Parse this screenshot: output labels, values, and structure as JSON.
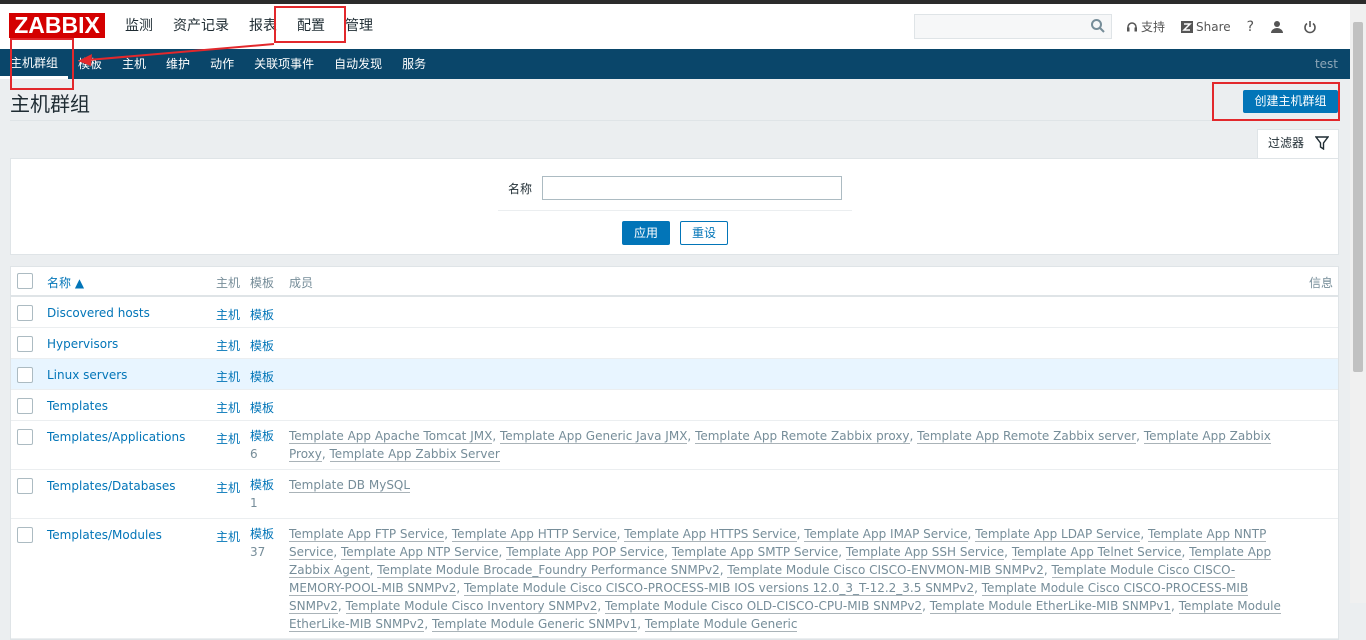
{
  "logo": "ZABBIX",
  "main_menu": [
    {
      "label": "监测"
    },
    {
      "label": "资产记录"
    },
    {
      "label": "报表"
    },
    {
      "label": "配置"
    },
    {
      "label": "管理"
    }
  ],
  "header_links": {
    "support": "支持",
    "share": "Share",
    "help": "?"
  },
  "sub_menu": [
    {
      "label": "主机群组"
    },
    {
      "label": "模板"
    },
    {
      "label": "主机"
    },
    {
      "label": "维护"
    },
    {
      "label": "动作"
    },
    {
      "label": "关联项事件"
    },
    {
      "label": "自动发现"
    },
    {
      "label": "服务"
    }
  ],
  "user": "test",
  "page_title": "主机群组",
  "create_button": "创建主机群组",
  "filter": {
    "tab_label": "过滤器",
    "name_label": "名称",
    "name_value": "",
    "apply": "应用",
    "reset": "重设"
  },
  "table": {
    "headers": {
      "name": "名称 ▲",
      "hosts": "主机",
      "templates": "模板",
      "members": "成员",
      "info": "信息"
    },
    "rows": [
      {
        "name": "Discovered hosts",
        "hosts": "主机",
        "templates": "模板",
        "count": "",
        "members": []
      },
      {
        "name": "Hypervisors",
        "hosts": "主机",
        "templates": "模板",
        "count": "",
        "members": []
      },
      {
        "name": "Linux servers",
        "hosts": "主机",
        "templates": "模板",
        "count": "",
        "members": []
      },
      {
        "name": "Templates",
        "hosts": "主机",
        "templates": "模板",
        "count": "",
        "members": []
      },
      {
        "name": "Templates/Applications",
        "hosts": "主机",
        "templates": "模板",
        "count": "6",
        "members": [
          "Template App Apache Tomcat JMX",
          "Template App Generic Java JMX",
          "Template App Remote Zabbix proxy",
          "Template App Remote Zabbix server",
          "Template App Zabbix Proxy",
          "Template App Zabbix Server"
        ]
      },
      {
        "name": "Templates/Databases",
        "hosts": "主机",
        "templates": "模板",
        "count": "1",
        "members": [
          "Template DB MySQL"
        ]
      },
      {
        "name": "Templates/Modules",
        "hosts": "主机",
        "templates": "模板",
        "count": "37",
        "members": [
          "Template App FTP Service",
          "Template App HTTP Service",
          "Template App HTTPS Service",
          "Template App IMAP Service",
          "Template App LDAP Service",
          "Template App NNTP Service",
          "Template App NTP Service",
          "Template App POP Service",
          "Template App SMTP Service",
          "Template App SSH Service",
          "Template App Telnet Service",
          "Template App Zabbix Agent",
          "Template Module Brocade_Foundry Performance SNMPv2",
          "Template Module Cisco CISCO-ENVMON-MIB SNMPv2",
          "Template Module Cisco CISCO-MEMORY-POOL-MIB SNMPv2",
          "Template Module Cisco CISCO-PROCESS-MIB IOS versions 12.0_3_T-12.2_3.5 SNMPv2",
          "Template Module Cisco CISCO-PROCESS-MIB SNMPv2",
          "Template Module Cisco Inventory SNMPv2",
          "Template Module Cisco OLD-CISCO-CPU-MIB SNMPv2",
          "Template Module EtherLike-MIB SNMPv1",
          "Template Module EtherLike-MIB SNMPv2",
          "Template Module Generic SNMPv1",
          "Template Module Generic"
        ]
      }
    ]
  }
}
